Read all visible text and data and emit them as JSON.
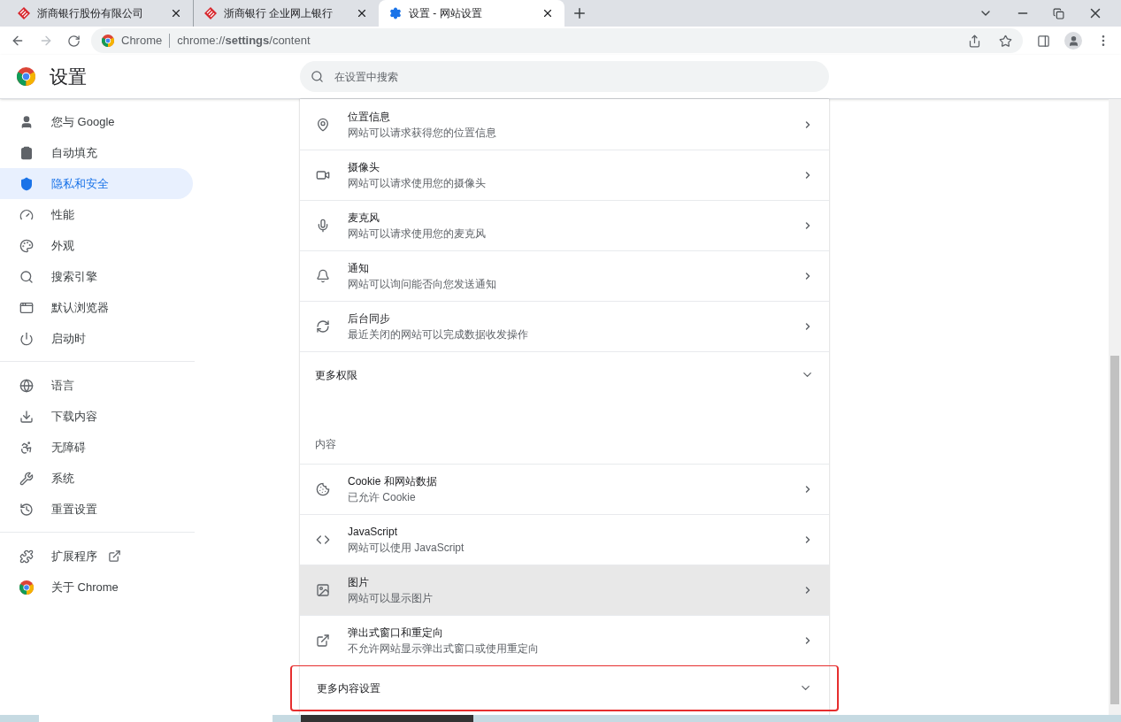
{
  "tabs": [
    {
      "title": "浙商银行股份有限公司",
      "selected": false
    },
    {
      "title": "浙商银行 企业网上银行",
      "selected": false
    },
    {
      "title": "设置 - 网站设置",
      "selected": true
    }
  ],
  "address": {
    "origin": "Chrome",
    "url": "chrome://**settings**/content"
  },
  "header": {
    "title": "设置",
    "search": {
      "placeholder": "在设置中搜索"
    }
  },
  "sidebar": {
    "groups": [
      [
        {
          "label": "您与 Google",
          "selected": false
        },
        {
          "label": "自动填充",
          "selected": false
        },
        {
          "label": "隐私和安全",
          "selected": true
        },
        {
          "label": "性能",
          "selected": false
        },
        {
          "label": "外观",
          "selected": false
        },
        {
          "label": "搜索引擎",
          "selected": false
        },
        {
          "label": "默认浏览器",
          "selected": false
        },
        {
          "label": "启动时",
          "selected": false
        }
      ],
      [
        {
          "label": "语言",
          "selected": false
        },
        {
          "label": "下载内容",
          "selected": false
        },
        {
          "label": "无障碍",
          "selected": false
        },
        {
          "label": "系统",
          "selected": false
        },
        {
          "label": "重置设置",
          "selected": false
        }
      ],
      [
        {
          "label": "扩展程序",
          "selected": false,
          "external": true
        },
        {
          "label": "关于 Chrome",
          "selected": false,
          "external": false
        }
      ]
    ]
  },
  "content": [
    {
      "kind": "row",
      "title": "位置信息",
      "subtitle": "网站可以请求获得您的位置信息",
      "hovered": false
    },
    {
      "kind": "row",
      "title": "摄像头",
      "subtitle": "网站可以请求使用您的摄像头",
      "hovered": false
    },
    {
      "kind": "row",
      "title": "麦克风",
      "subtitle": "网站可以请求使用您的麦克风",
      "hovered": false
    },
    {
      "kind": "row",
      "title": "通知",
      "subtitle": "网站可以询问能否向您发送通知",
      "hovered": false
    },
    {
      "kind": "row",
      "title": "后台同步",
      "subtitle": "最近关闭的网站可以完成数据收发操作",
      "hovered": false
    },
    {
      "kind": "expander",
      "title": "更多权限",
      "highlighted": false
    },
    {
      "kind": "heading",
      "title": "内容"
    },
    {
      "kind": "row",
      "title": "Cookie 和网站数据",
      "subtitle": "已允许 Cookie",
      "hovered": false
    },
    {
      "kind": "row",
      "title": "JavaScript",
      "subtitle": "网站可以使用 JavaScript",
      "hovered": false
    },
    {
      "kind": "row",
      "title": "图片",
      "subtitle": "网站可以显示图片",
      "hovered": true
    },
    {
      "kind": "row",
      "title": "弹出式窗口和重定向",
      "subtitle": "不允许网站显示弹出式窗口或使用重定向",
      "hovered": false
    },
    {
      "kind": "expander",
      "title": "更多内容设置",
      "highlighted": true
    }
  ]
}
